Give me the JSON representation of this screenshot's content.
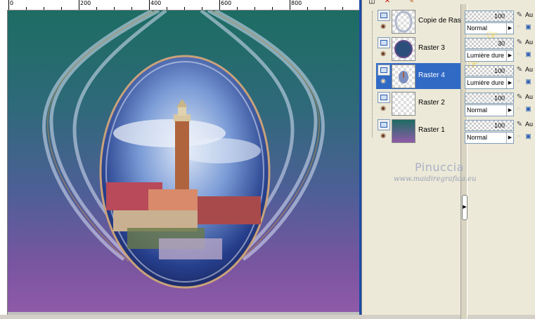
{
  "ruler": {
    "labels": [
      "0",
      "200",
      "400",
      "600",
      "800"
    ]
  },
  "palette": {
    "toolbar_icons": [
      "new-layer-icon",
      "delete-icon",
      "brush-icon"
    ],
    "layers": [
      {
        "name": "Copie de Ras",
        "opacity": "100",
        "blend": "Normal",
        "auto": "Au",
        "thumb": "frame",
        "selected": false
      },
      {
        "name": "Raster 3",
        "opacity": "30",
        "blend": "Lumière dure",
        "auto": "Au",
        "thumb": "sphere",
        "selected": false
      },
      {
        "name": "Raster 4",
        "opacity": "100",
        "blend": "Lumière dure",
        "auto": "Au",
        "thumb": "tower",
        "selected": true
      },
      {
        "name": "Raster 2",
        "opacity": "100",
        "blend": "Normal",
        "auto": "Au",
        "thumb": "empty",
        "selected": false
      },
      {
        "name": "Raster 1",
        "opacity": "100",
        "blend": "Normal",
        "auto": "Au",
        "thumb": "gradient",
        "selected": false
      }
    ]
  },
  "watermark": {
    "title": "Pinuccia",
    "url": "www.maidiregrafica.eu"
  },
  "colors": {
    "canvas_top": "#1d6c63",
    "canvas_bottom": "#8f5aa8",
    "selection": "#316ac5",
    "pointer": "#f2c200"
  }
}
